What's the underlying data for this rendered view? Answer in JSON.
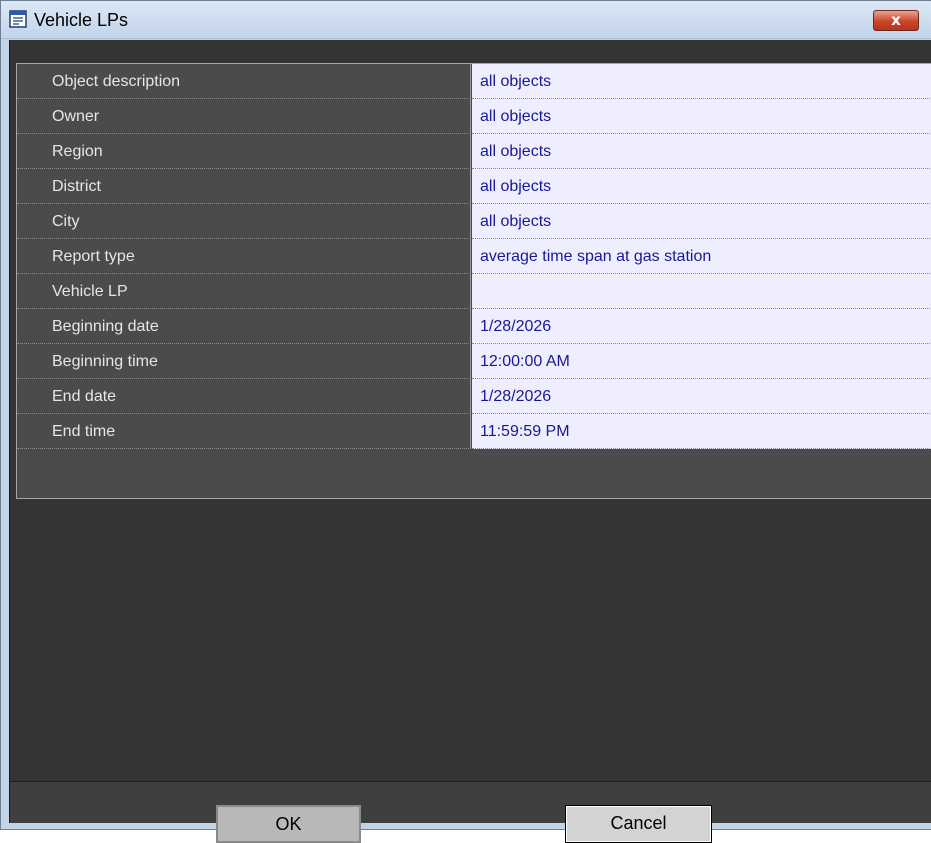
{
  "window": {
    "title": "Vehicle LPs",
    "close_label": "x"
  },
  "properties": [
    {
      "label": "Object description",
      "value": "all objects"
    },
    {
      "label": "Owner",
      "value": "all objects"
    },
    {
      "label": "Region",
      "value": "all objects"
    },
    {
      "label": "District",
      "value": "all objects"
    },
    {
      "label": "City",
      "value": "all objects"
    },
    {
      "label": "Report type",
      "value": "average time span at gas station"
    },
    {
      "label": "Vehicle LP",
      "value": ""
    },
    {
      "label": "Beginning date",
      "value": "1/28/2026"
    },
    {
      "label": "Beginning time",
      "value": "12:00:00 AM"
    },
    {
      "label": "End date",
      "value": "1/28/2026"
    },
    {
      "label": "End time",
      "value": "11:59:59 PM"
    }
  ],
  "buttons": {
    "ok_label": "OK",
    "cancel_label": "Cancel"
  },
  "colors": {
    "label_bg": "#4b4b4b",
    "value_bg": "#eeeeff",
    "value_text": "#18189c",
    "panel_bg": "#343434"
  }
}
